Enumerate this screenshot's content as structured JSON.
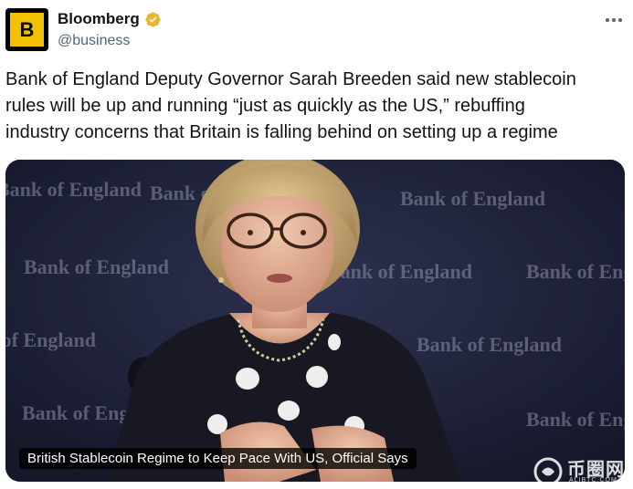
{
  "author": {
    "avatar_letter": "B",
    "display_name": "Bloomberg",
    "handle": "@business",
    "verified_badge_color": "#e8b829"
  },
  "menu": {
    "icon": "more-dots-icon"
  },
  "tweet": {
    "lines": [
      "Bank of England Deputy Governor Sarah Breeden said new stablecoin",
      "rules will be up and running “just as quickly as the US,” rebuffing",
      "industry concerns that Britain is falling behind on setting up a regime"
    ]
  },
  "media": {
    "caption": "British Stablecoin Regime to Keep Pace With US, Official Says",
    "backdrop_text": "Bank of England"
  },
  "watermark": {
    "name": "币圈网",
    "sub": "ALIBTC.COM"
  },
  "colors": {
    "accent": "#f2c200",
    "text": "#0f1419",
    "secondary": "#536471"
  }
}
